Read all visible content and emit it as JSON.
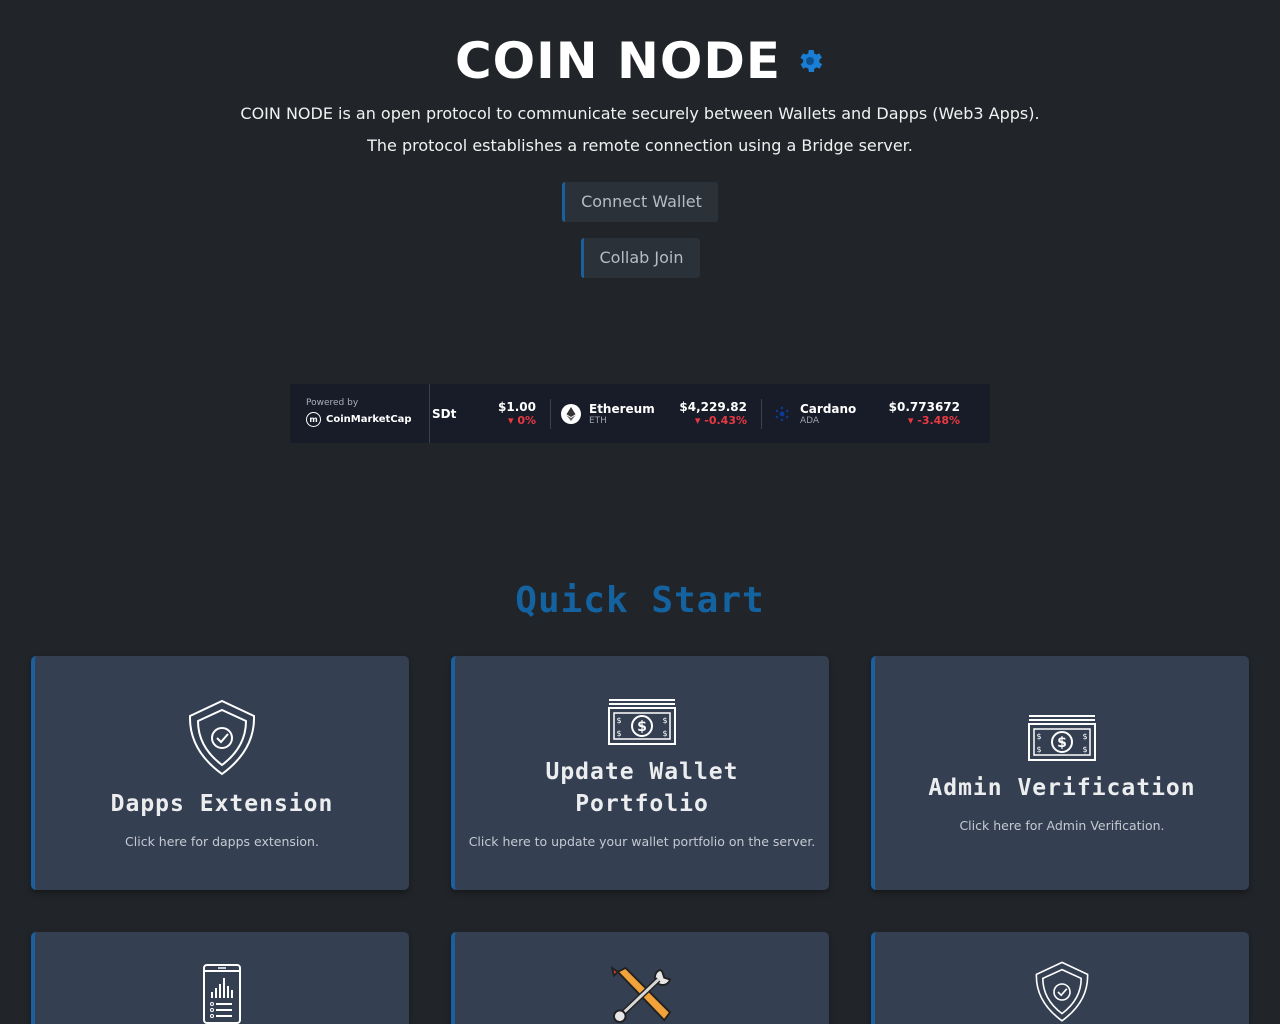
{
  "header": {
    "title": "COIN NODE",
    "description_line1": "COIN NODE is an open protocol to communicate securely between Wallets and Dapps (Web3 Apps).",
    "description_line2": "The protocol establishes a remote connection using a Bridge server."
  },
  "buttons": {
    "connect_wallet": "Connect Wallet",
    "collab_join": "Collab Join"
  },
  "ticker": {
    "powered_by": "Powered by",
    "brand": "CoinMarketCap",
    "coins": [
      {
        "name": "SDt",
        "symbol": "",
        "price": "$1.00",
        "change": "0%",
        "icon": "none"
      },
      {
        "name": "Ethereum",
        "symbol": "ETH",
        "price": "$4,229.82",
        "change": "-0.43%",
        "icon": "ethereum-icon"
      },
      {
        "name": "Cardano",
        "symbol": "ADA",
        "price": "$0.773672",
        "change": "-3.48%",
        "icon": "cardano-icon"
      }
    ],
    "negative_color": "#ea3943"
  },
  "quick_start": {
    "title": "Quick Start",
    "cards": [
      {
        "title": "Dapps Extension",
        "text": "Click here for dapps extension.",
        "icon": "shield-check-icon"
      },
      {
        "title": "Update Wallet Portfolio",
        "text": "Click here to update your wallet portfolio on the server.",
        "icon": "banknote-icon"
      },
      {
        "title": "Admin Verification",
        "text": "Click here for Admin Verification.",
        "icon": "banknote-icon"
      }
    ],
    "row2_icons": [
      "phone-chart-icon",
      "tools-icon",
      "shield-check-icon"
    ]
  },
  "colors": {
    "background": "#212529",
    "card": "#343f52",
    "accent": "#1463a0"
  }
}
